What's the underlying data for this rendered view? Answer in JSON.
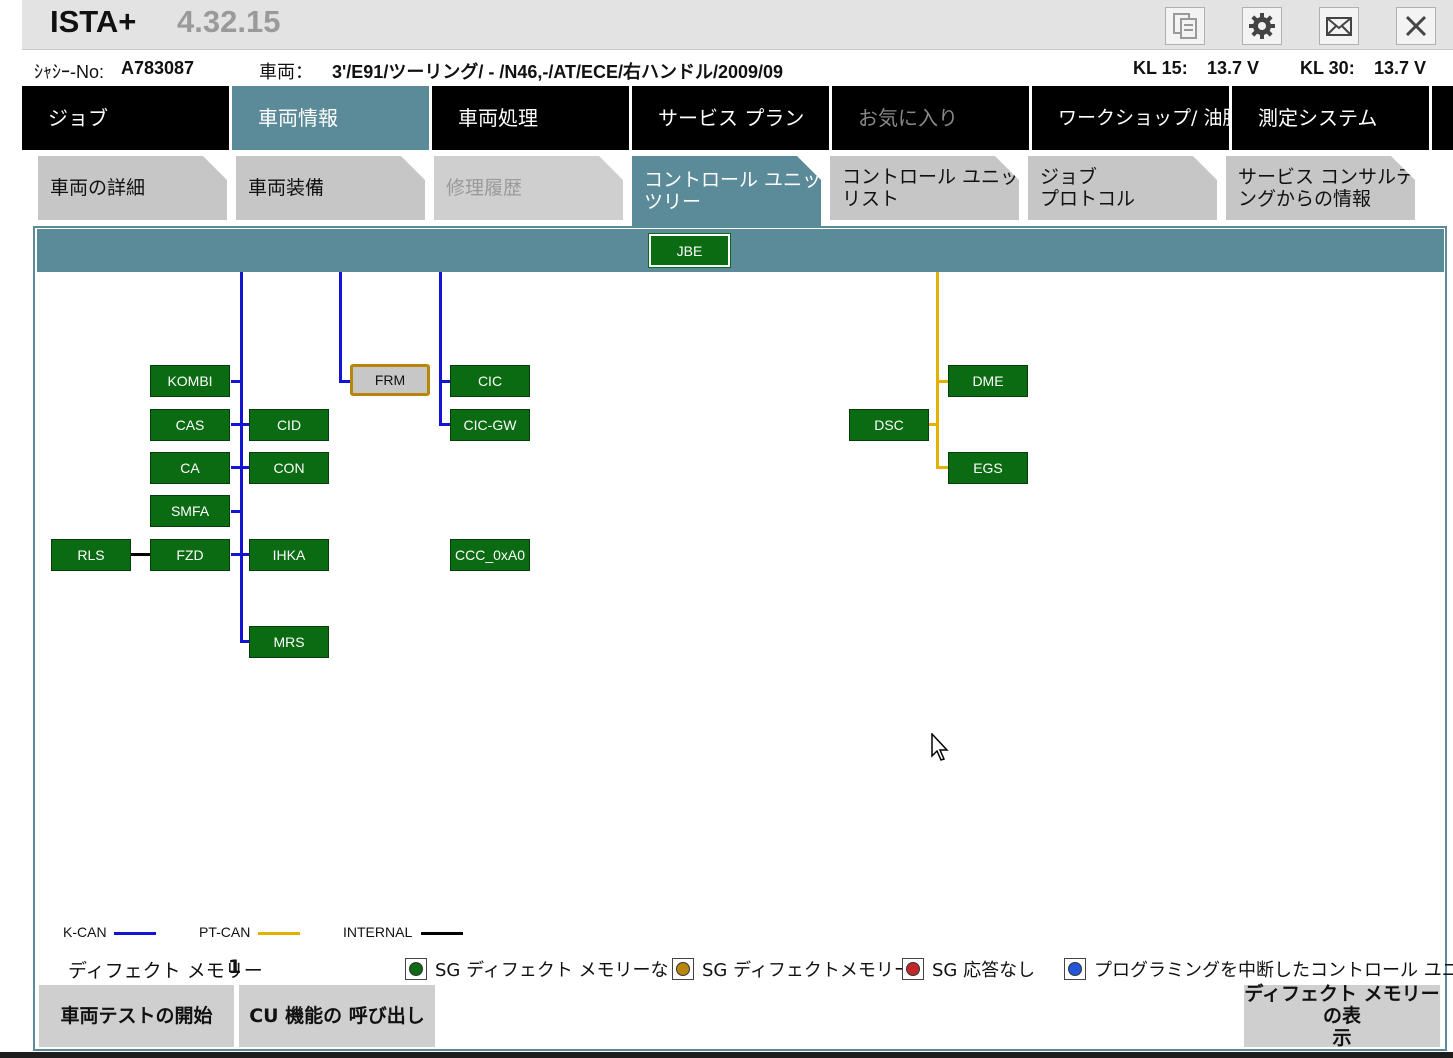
{
  "app": {
    "name": "ISTA+",
    "version": "4.32.15"
  },
  "titlebar_buttons": [
    {
      "icon": "document-copy-icon"
    },
    {
      "icon": "gear-icon"
    },
    {
      "icon": "mail-icon"
    },
    {
      "icon": "close-icon"
    }
  ],
  "info": {
    "chassis_label": "ｼｬｼｰ-No:",
    "chassis_value": "A783087",
    "vehicle_label": "車両：",
    "vehicle_value": "3'/E91/ツーリング/ - /N46,-/AT/ECE/右ハンドル/2009/09",
    "kl15_label": "KL 15:",
    "kl15_value": "13.7 V",
    "kl30_label": "KL 30:",
    "kl30_value": "13.7 V"
  },
  "mainnav": [
    {
      "label": "ジョブ",
      "state": "normal"
    },
    {
      "label": "車両情報",
      "state": "active"
    },
    {
      "label": "車両処理",
      "state": "normal"
    },
    {
      "label": "サービス プラン",
      "state": "normal"
    },
    {
      "label": "お気に入り",
      "state": "disabled"
    },
    {
      "label": "ワークショップ/ 油脂類",
      "state": "normal"
    },
    {
      "label": "測定システム",
      "state": "normal"
    }
  ],
  "subtabs": [
    {
      "line1": "車両の詳細",
      "line2": "",
      "state": "normal"
    },
    {
      "line1": "車両装備",
      "line2": "",
      "state": "normal"
    },
    {
      "line1": "修理履歴",
      "line2": "",
      "state": "disabled"
    },
    {
      "line1": "コントロール ユニット",
      "line2": "ツリー",
      "state": "active"
    },
    {
      "line1": "コントロール ユニット",
      "line2": "リスト",
      "state": "normal"
    },
    {
      "line1": "ジョブ",
      "line2": "プロトコル",
      "state": "normal"
    },
    {
      "line1": "サービス コンサルティ",
      "line2": "ングからの情報",
      "state": "normal"
    }
  ],
  "ecus": {
    "jbe": "JBE",
    "kombi": "KOMBI",
    "cas": "CAS",
    "ca": "CA",
    "smfa": "SMFA",
    "fzd": "FZD",
    "rls": "RLS",
    "cid": "CID",
    "con": "CON",
    "ihka": "IHKA",
    "mrs": "MRS",
    "frm": "FRM",
    "cic": "CIC",
    "cicgw": "CIC-GW",
    "ccc": "CCC_0xA0",
    "dsc": "DSC",
    "dme": "DME",
    "egs": "EGS"
  },
  "bus_legend": {
    "kcan": "K-CAN",
    "ptcan": "PT-CAN",
    "internal": "INTERNAL",
    "colors": {
      "kcan": "#1414d4",
      "ptcan": "#e5b000",
      "internal": "#000000"
    }
  },
  "defect": {
    "label": "ディフェクト メモリー",
    "count": "1"
  },
  "status_legend": [
    {
      "label": "SG ディフェクト メモリーなし",
      "color": "#0a6b12"
    },
    {
      "label": "SG ディフェクトメモリー",
      "color": "#b8860b"
    },
    {
      "label": "SG 応答なし",
      "color": "#c0282a"
    },
    {
      "label": "プログラミングを中断したコントロール ユニット",
      "color": "#2255d8"
    }
  ],
  "buttons": {
    "start_test": "車両テストの開始",
    "cu_call": "CU 機能の 呼び出し",
    "show_defect_line1": "ディフェクト メモリーの表",
    "show_defect_line2": "示"
  }
}
